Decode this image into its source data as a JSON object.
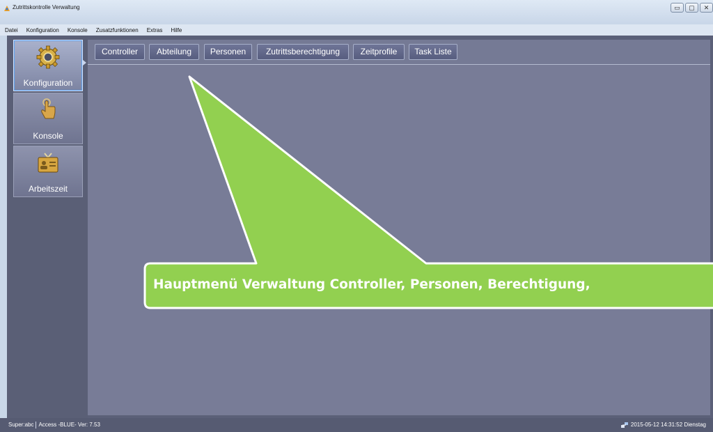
{
  "window": {
    "title": "Zutrittskontrolle Verwaltung",
    "controls": [
      "▭",
      "▢",
      "✕"
    ]
  },
  "menu": [
    "Datei",
    "Konfiguration",
    "Konsole",
    "Zusatzfunktionen",
    "Extras",
    "Hilfe"
  ],
  "sidebar": {
    "items": [
      {
        "label": "Konfiguration",
        "icon": "gear-icon",
        "active": true
      },
      {
        "label": "Konsole",
        "icon": "hand-pointer-icon",
        "active": false
      },
      {
        "label": "Arbeitszeit",
        "icon": "id-card-icon",
        "active": false
      }
    ]
  },
  "tabs": [
    "Controller",
    "Abteilung",
    "Personen",
    "Zutrittsberechtigung",
    "Zeitprofile",
    "Task Liste"
  ],
  "callout": {
    "text": "Hauptmenü Verwaltung Controller, Personen, Berechtigung,",
    "color": "#92d050",
    "border_color": "#ffffff"
  },
  "status": {
    "user": "Super:abc",
    "info": "Access -BLUE- Ver: 7.53",
    "datetime": "2015-05-12 14:31:52 Dienstag"
  },
  "colors": {
    "panel": "#787c97",
    "sidebar": "#5a5f76",
    "statusbar": "#565b72"
  }
}
